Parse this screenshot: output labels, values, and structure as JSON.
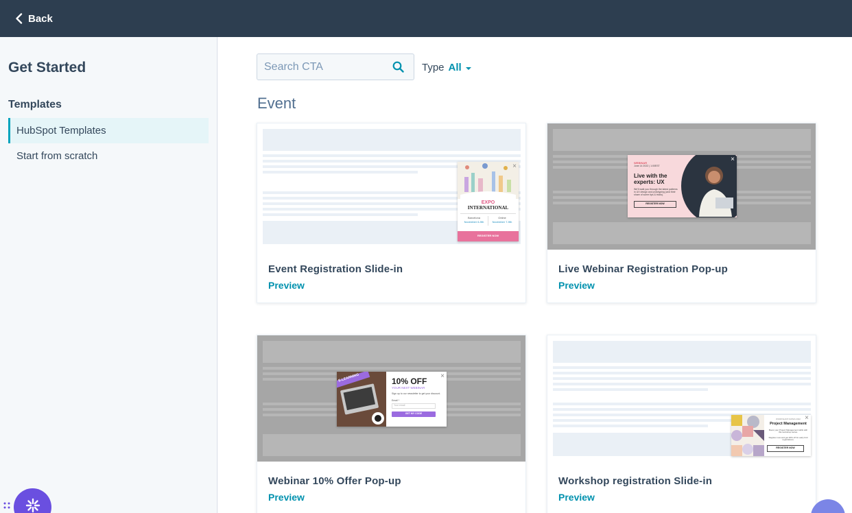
{
  "topbar": {
    "back_label": "Back"
  },
  "sidebar": {
    "title": "Get Started",
    "section": "Templates",
    "items": [
      {
        "label": "HubSpot Templates",
        "active": true
      },
      {
        "label": "Start from scratch",
        "active": false
      }
    ]
  },
  "filters": {
    "search_placeholder": "Search CTA",
    "type_label": "Type",
    "type_value": "All"
  },
  "section_heading": "Event",
  "cards": [
    {
      "title": "Event Registration Slide-in",
      "link": "Preview",
      "popup": {
        "line1": "EXPO",
        "line2": "INTERNATIONAL",
        "col1_city": "Barcelona",
        "col1_date": "November 6-9th",
        "col2_city": "Online",
        "col2_date": "November 7-9th",
        "button": "REGISTER NOW"
      }
    },
    {
      "title": "Live Webinar Registration Pop-up",
      "link": "Preview",
      "popup": {
        "kicker": "WEBINAR",
        "date": "June 14 2022 | 1:00EST",
        "headline": "Live with the experts: UX",
        "body": "We'll walk you through the latest patterns in UX design and prototyping (and their share of some tips & tricks).",
        "button": "REGISTER NOW"
      }
    },
    {
      "title": "Webinar 10% Offer Pop-up",
      "link": "Preview",
      "popup": {
        "ribbon": "E-LEARNING",
        "headline": "10% OFF",
        "subhead": "YOUR NEXT WEBINAR",
        "body": "Sign up to our newsletter to get your discount.",
        "email_label": "Email *",
        "email_placeholder": "Your email",
        "button": "GET MY CODE"
      }
    },
    {
      "title": "Workshop registration Slide-in",
      "link": "Preview",
      "popup": {
        "kicker": "WORKSHOP DATES 2022",
        "headline": "Project Management",
        "body": "Boost your Project Management skills with this workshop series.",
        "body2": "Register now and get 20% off for early bird registrations.",
        "button": "REGISTER NOW"
      }
    }
  ],
  "colors": {
    "accent": "#0091ae",
    "topbar": "#2d3e50",
    "brand_button": "#6a4fe0"
  }
}
